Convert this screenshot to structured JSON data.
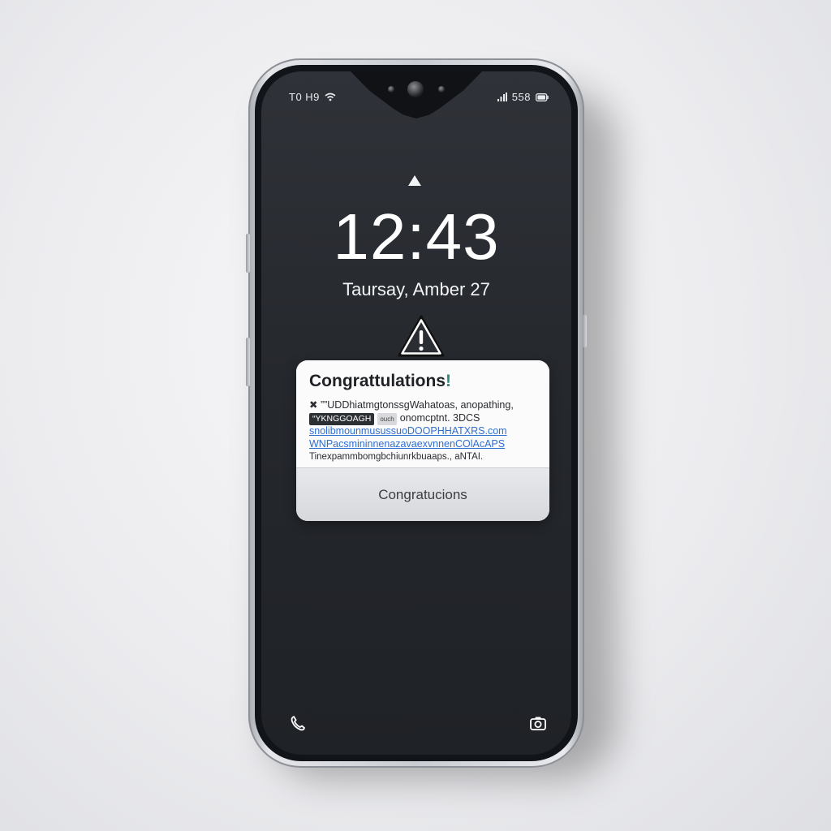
{
  "status_bar": {
    "left_text": "T0 H9",
    "right_text": "558"
  },
  "lock_screen": {
    "time": "12:43",
    "date": "Taursay, Amber 27"
  },
  "notification": {
    "title": "Congrattulations",
    "title_exclamation": "!",
    "line1": "✖ ””UDDhiatmgtonssgWahatoas, anopathing,",
    "line2_tag": "“YKNGGOAGH",
    "line2_tag_small": "ouch",
    "line2": "onomcptnt. 3DCS",
    "line3": "snolibmounmusussuoDOOPHHATXRS.com",
    "line4": "WNPacsmininnenazavaexvnnenCOlAcAPS",
    "line5": "Tinexpammbomgbchiunrkbuaaps., aNTAI.",
    "action_label": "Congratucions"
  },
  "icons": {
    "wifi": "wifi-icon",
    "signal": "signal-icon",
    "battery": "battery-icon",
    "lock": "lock-icon",
    "warning": "warning-triangle-icon",
    "phone": "phone-icon",
    "camera": "camera-icon"
  },
  "colors": {
    "screen": "#25282d",
    "card": "#fbfbfc",
    "link": "#2f6fd0",
    "accent_exclamation": "#2a8a7e"
  }
}
